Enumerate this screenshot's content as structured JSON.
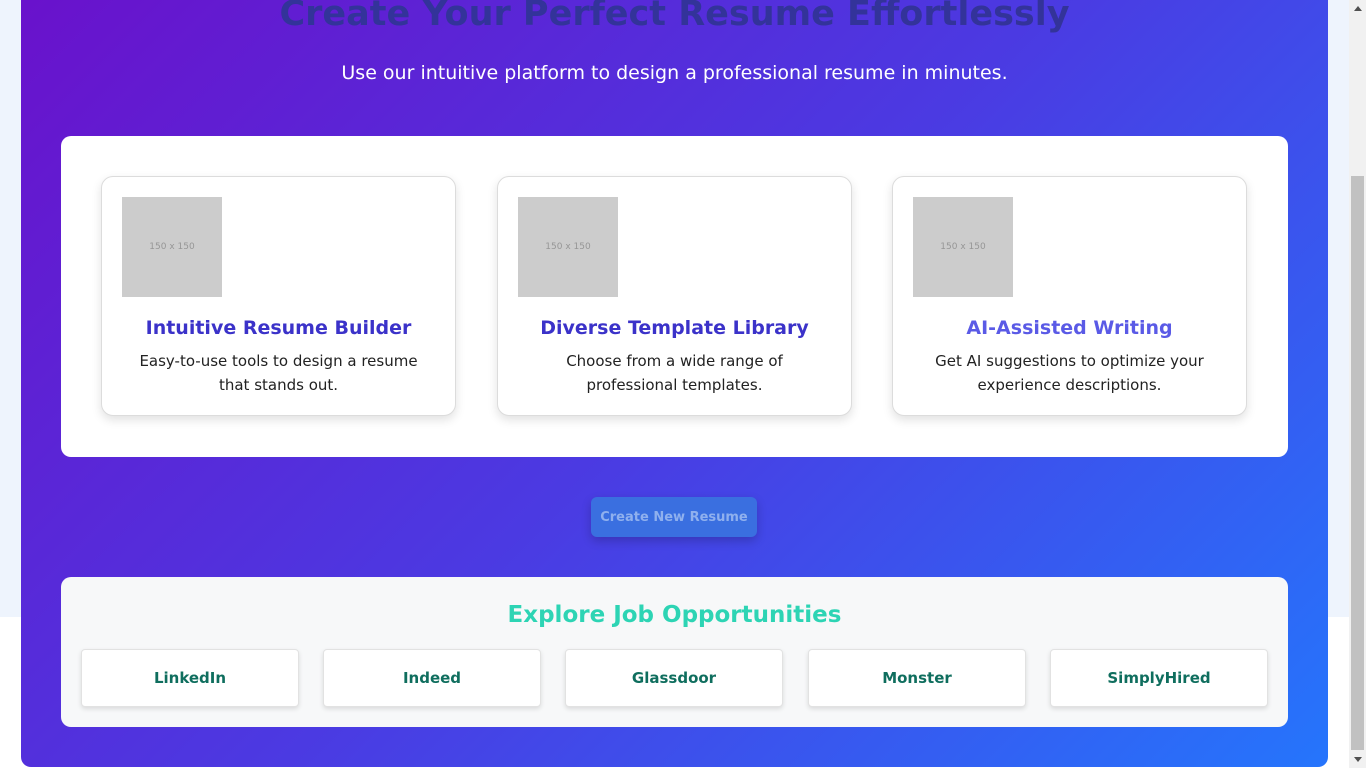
{
  "hero": {
    "title": "Create Your Perfect Resume Effortlessly",
    "subtitle": "Use our intuitive platform to design a professional resume in minutes."
  },
  "features": [
    {
      "image_placeholder": "150 x 150",
      "title": "Intuitive Resume Builder",
      "description": "Easy-to-use tools to design a resume that stands out.",
      "title_color": "#3b32c9"
    },
    {
      "image_placeholder": "150 x 150",
      "title": "Diverse Template Library",
      "description": "Choose from a wide range of professional templates.",
      "title_color": "#3b32c9"
    },
    {
      "image_placeholder": "150 x 150",
      "title": "AI-Assisted Writing",
      "description": "Get AI suggestions to optimize your experience descriptions.",
      "title_color": "#5a5ae6"
    }
  ],
  "cta": {
    "label": "Create New Resume"
  },
  "jobs": {
    "title": "Explore Job Opportunities",
    "links": [
      "LinkedIn",
      "Indeed",
      "Glassdoor",
      "Monster",
      "SimplyHired"
    ]
  },
  "colors": {
    "gradient_start": "#6a11cb",
    "gradient_end": "#2575fc",
    "jobs_title": "#2dd4b4",
    "job_link_text": "#0f6e5e"
  }
}
